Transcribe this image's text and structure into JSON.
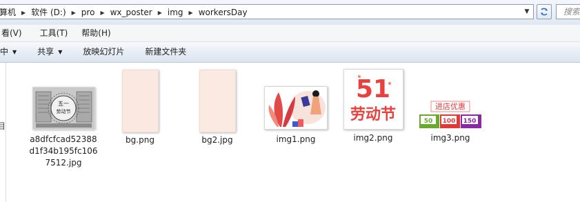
{
  "address_bar": {
    "crumbs": [
      "算机",
      "软件 (D:)",
      "pro",
      "wx_poster",
      "img",
      "workersDay"
    ],
    "search_placeholder": "搜索"
  },
  "menu": [
    "看(V)",
    "工具(T)",
    "帮助(H)"
  ],
  "toolbar": {
    "share_with": "中",
    "burn": "共享",
    "slideshow": "放映幻灯片",
    "new_folder": "新建文件夹"
  },
  "nav_glyph": "目",
  "files": [
    {
      "name": "a8dfcfcad52388d1f34b195fc1067512.jpg",
      "name_lines": [
        "a8dfcfcad52388",
        "d1f34b195fc106",
        "7512.jpg"
      ],
      "thumb": "sketch"
    },
    {
      "name": "bg.png",
      "name_lines": [
        "bg.png"
      ],
      "thumb": "blank"
    },
    {
      "name": "bg2.jpg",
      "name_lines": [
        "bg2.jpg"
      ],
      "thumb": "blank"
    },
    {
      "name": "img1.png",
      "name_lines": [
        "img1.png"
      ],
      "thumb": "leaf-figure"
    },
    {
      "name": "img2.png",
      "name_lines": [
        "img2.png"
      ],
      "thumb": "labor-day"
    },
    {
      "name": "img3.png",
      "name_lines": [
        "img3.png"
      ],
      "thumb": "coupons"
    }
  ],
  "thumb_text": {
    "sketch_title": "五一劳动节",
    "img2_number": "51",
    "img2_text": "劳动节",
    "img3_banner": "进店优惠",
    "img3_coupons": [
      "50",
      "100",
      "150"
    ]
  },
  "colors": {
    "blank_thumb": "#fbe9e1",
    "labor_red": "#e8413e",
    "coupon_green": "#6aa82e",
    "coupon_red": "#e0393a",
    "coupon_purple": "#8a2aa0"
  }
}
